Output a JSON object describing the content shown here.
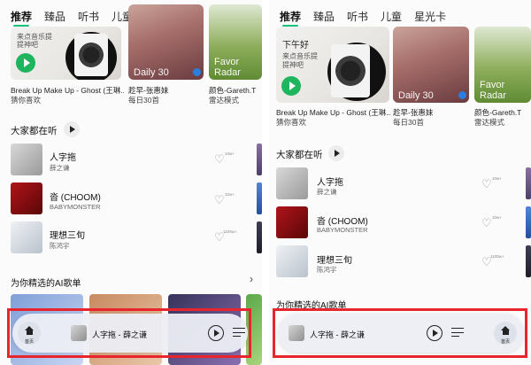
{
  "tabs": [
    "推荐",
    "臻品",
    "听书",
    "儿童",
    "星光卡"
  ],
  "banners": {
    "card1": {
      "tagline_small": "来点音乐提",
      "tagline_small2": "提神吧",
      "greeting": "下午好"
    },
    "card2": {
      "caption": "Daily 30"
    },
    "card3": {
      "caption": "Favor Radar"
    }
  },
  "banner_subs": {
    "item1": {
      "line1": "Break Up Make Up - Ghost (王琳...",
      "line2": "猜你喜欢"
    },
    "item2": {
      "line1": "趁早-张惠妹",
      "line2": "每日30首"
    },
    "item3": {
      "line1": "颜色-Gareth.T",
      "line2": "雷达模式"
    }
  },
  "section_listening": "大家都在听",
  "songs": [
    {
      "title": "人字拖",
      "artist": "薛之谦",
      "count": "10w+"
    },
    {
      "title": "沓 (CHOOM)",
      "artist": "BABYMONSTER",
      "count": "10w+"
    },
    {
      "title": "理想三旬",
      "artist": "陈鸿宇",
      "count": "1100w+"
    }
  ],
  "section_ai": "为你精选的AI歌单",
  "player": {
    "now_playing": "人字拖 - 薛之谦",
    "home_label": "首页"
  },
  "icons": {
    "heart": "♡",
    "chevron": "›",
    "home": "home-icon"
  },
  "colors": {
    "accent": "#16c27a",
    "highlight": "#e8242d"
  }
}
